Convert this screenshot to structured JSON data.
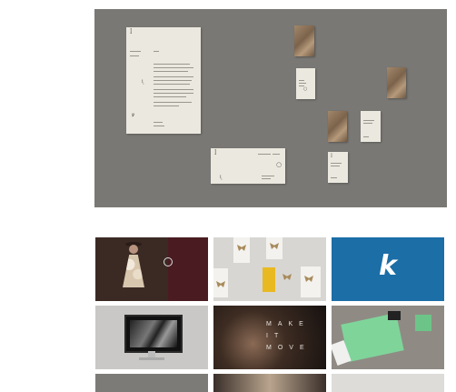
{
  "gallery": {
    "hero": {
      "name": "stationery-mockup"
    },
    "tiles": [
      {
        "name": "tile-portrait-dress"
      },
      {
        "name": "tile-butterfly-prints"
      },
      {
        "name": "tile-k-logo",
        "logo": "k"
      },
      {
        "name": "tile-desktop-monitor"
      },
      {
        "name": "tile-make-it-move",
        "text": "MAKE IT MOVE"
      },
      {
        "name": "tile-green-stationery"
      },
      {
        "name": "tile-partial-1"
      },
      {
        "name": "tile-partial-2"
      },
      {
        "name": "tile-partial-3"
      }
    ]
  },
  "colors": {
    "hero_background": "#7a7874",
    "brand_blue": "#1b6ea6",
    "mint_green": "#7fd49a"
  }
}
